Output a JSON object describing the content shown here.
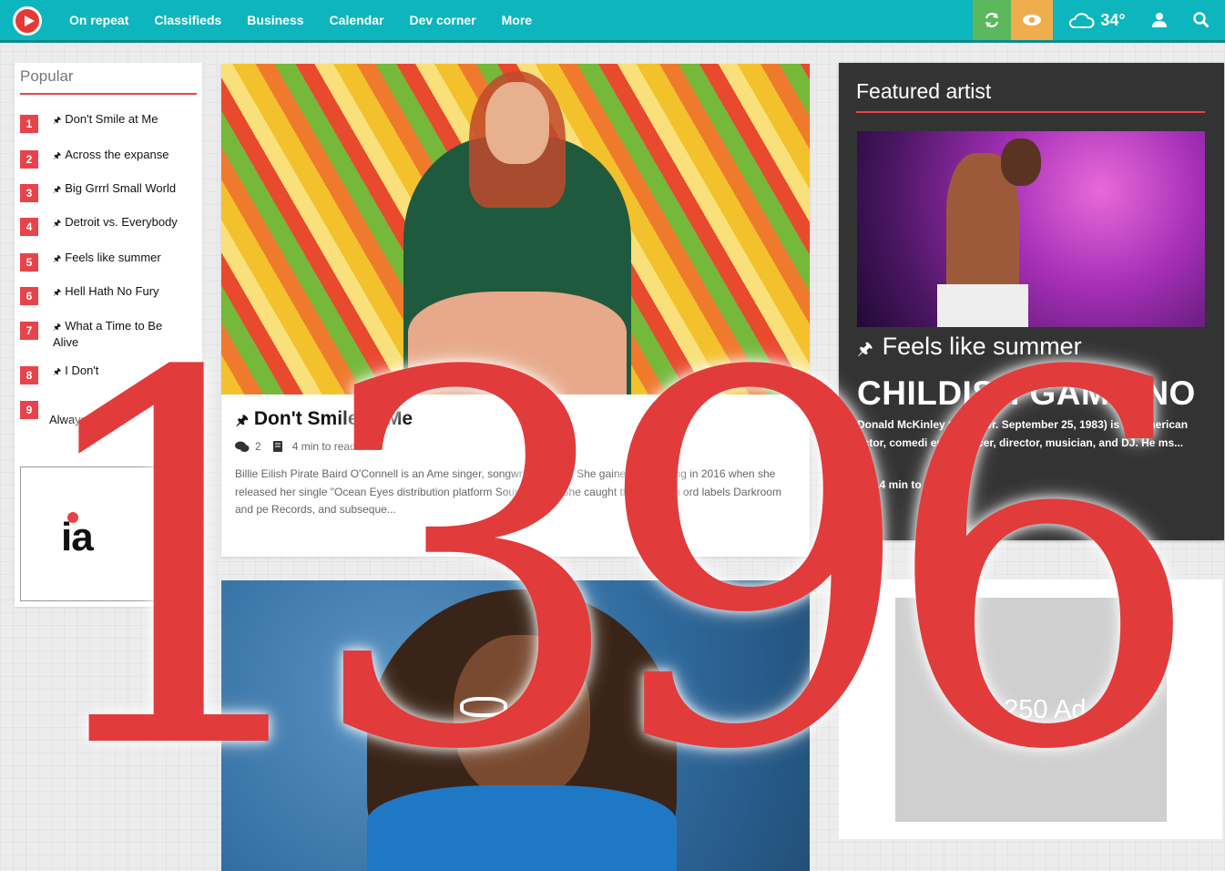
{
  "topbar": {
    "nav": [
      "On repeat",
      "Classifieds",
      "Business",
      "Calendar",
      "Dev corner",
      "More"
    ],
    "temperature": "34°",
    "icons": {
      "logo": "play-logo-icon",
      "refresh": "refresh-icon",
      "eye": "eye-icon",
      "weather": "cloud-icon",
      "user": "user-icon",
      "search": "search-icon"
    },
    "colors": {
      "bar": "#0db6bd",
      "refresh": "#5cb85c",
      "eye": "#f0ad4e"
    }
  },
  "popular": {
    "title": "Popular",
    "items": [
      {
        "num": "1",
        "title": "Don't Smile at Me"
      },
      {
        "num": "2",
        "title": "Across the expanse"
      },
      {
        "num": "3",
        "title": "Big Grrrl Small World"
      },
      {
        "num": "4",
        "title": "Detroit vs. Everybody"
      },
      {
        "num": "5",
        "title": "Feels like summer"
      },
      {
        "num": "6",
        "title": "Hell Hath No Fury"
      },
      {
        "num": "7",
        "title": "What a Time to Be Alive"
      },
      {
        "num": "8",
        "title": "I Don't"
      },
      {
        "num": "9",
        "title": "Always A"
      }
    ],
    "ad_logo": "ia"
  },
  "main_article": {
    "title": "Don't Smile at Me",
    "comments": "2",
    "read_time": "4 min to read",
    "excerpt": "Billie Eilish Pirate Baird O'Connell is an Ame singer, songwriter model. She gained a following in 2016 when she released her single \"Ocean Eyes distribution platform SoundCloud. She caught the attention ord labels Darkroom and pe Records, and subseque..."
  },
  "featured": {
    "heading": "Featured artist",
    "song": "Feels like summer",
    "artist": "CHILDISH GAMBINO",
    "description": "Donald McKinley Glover Jr. September 25, 1983) is an American actor, comedi er, producer, director, musician, and DJ. He ms...",
    "read_time": "14 min to read"
  },
  "ad_right": {
    "label": "0x250 Ad"
  },
  "watermark": {
    "text": "1396",
    "color": "#e23b3b"
  }
}
